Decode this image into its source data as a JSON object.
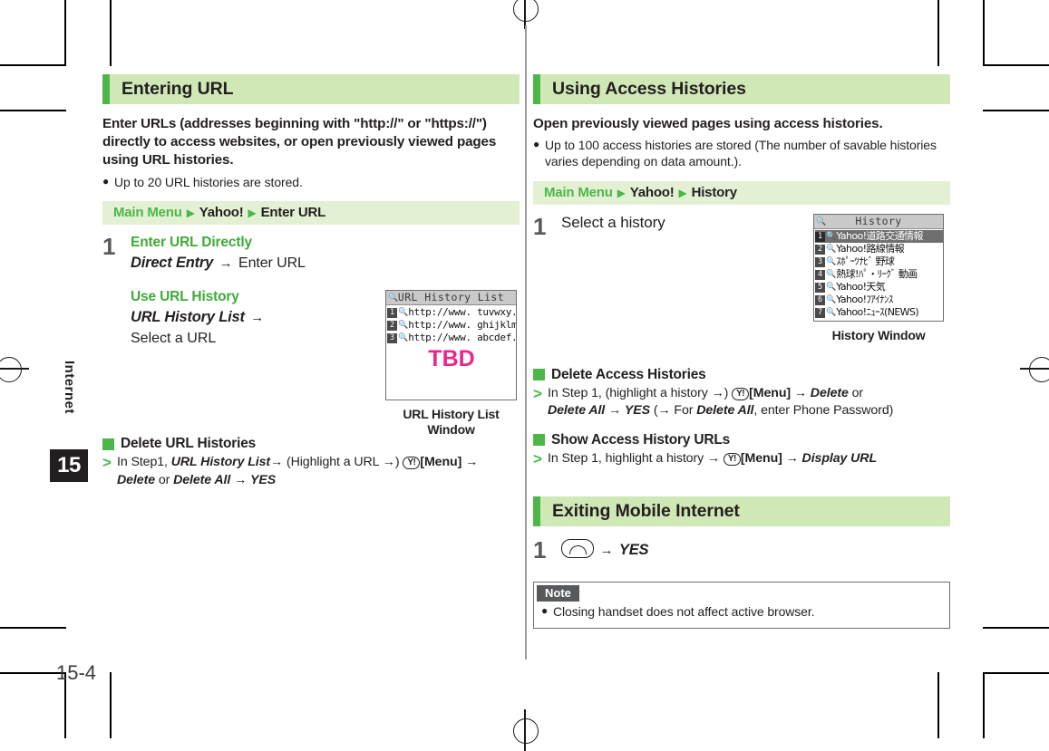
{
  "page": {
    "page_number": "15-4",
    "chapter_tab_label": "Internet",
    "chapter_number": "15"
  },
  "colors": {
    "accent_green": "#4cb748",
    "heading_bg": "#cfe8b6",
    "navbar_bg": "#e3f0d3",
    "tbd_magenta": "#e9268f",
    "note_header_bg": "#58595b"
  },
  "left_column": {
    "section": {
      "title": "Entering URL",
      "lead": "Enter URLs (addresses beginning with \"http://\" or \"https://\") directly to access websites, or open previously viewed pages using URL histories.",
      "bullets": [
        "Up to 20 URL histories are stored."
      ],
      "navbar": {
        "root": "Main Menu",
        "crumbs": [
          "Yahoo!",
          "Enter URL"
        ]
      },
      "step": {
        "number": "1",
        "block_a": {
          "heading": "Enter URL Directly",
          "italic": "Direct Entry",
          "arrow": "→",
          "tail": "Enter URL"
        },
        "block_b": {
          "heading": "Use URL History",
          "italic": "URL History List",
          "arrow": "→",
          "tail": "Select a URL"
        }
      },
      "screenshot": {
        "title": "URL History List",
        "magnifier_icon": "magnifier-icon",
        "rows": [
          {
            "index": "1",
            "text": "http://www. tuvwxy. xx",
            "selected": false
          },
          {
            "index": "2",
            "text": "http://www. ghijklmno",
            "selected": false
          },
          {
            "index": "3",
            "text": "http://www. abcdef. xx",
            "selected": false
          }
        ],
        "overlay_text": "TBD",
        "caption_line1": "URL History List",
        "caption_line2": "Window"
      },
      "subsections": [
        {
          "title": "Delete URL Histories",
          "line1_prefix": "In Step1, ",
          "line1_italic1": "URL History List",
          "line1_arrow1": "→",
          "line1_mid": " (Highlight a URL ",
          "line1_arrow2": "→",
          "line1_mid2": ") ",
          "key_icon": "yahoo-key-icon",
          "key_label": "Y!",
          "line1_menu": "[Menu]",
          "line1_arrow3": "→",
          "line2_italic1": "Delete",
          "line2_or": " or ",
          "line2_italic2": "Delete All",
          "line2_arrow": "→",
          "line2_italic3": "YES"
        }
      ]
    }
  },
  "right_column": {
    "section_histories": {
      "title": "Using Access Histories",
      "lead": "Open previously viewed pages using access histories.",
      "bullets": [
        "Up to 100 access histories are stored (The number of savable histories varies depending on data amount.)."
      ],
      "navbar": {
        "root": "Main Menu",
        "crumbs": [
          "Yahoo!",
          "History"
        ]
      },
      "step": {
        "number": "1",
        "text": "Select a history"
      },
      "screenshot": {
        "title": "History",
        "magnifier_icon": "magnifier-icon",
        "rows": [
          {
            "index": "1",
            "text": "Yahoo!道路交通情報",
            "selected": true
          },
          {
            "index": "2",
            "text": "Yahoo!路線情報",
            "selected": false
          },
          {
            "index": "3",
            "text": "ｽﾎﾟｰﾂﾅﾋﾞ 野球",
            "selected": false
          },
          {
            "index": "4",
            "text": "熱球!ﾊﾟ・ﾘｰｸﾞ 動画",
            "selected": false
          },
          {
            "index": "5",
            "text": "Yahoo!天気",
            "selected": false
          },
          {
            "index": "6",
            "text": "Yahoo!ﾌｱｲﾅﾝｽ",
            "selected": false
          },
          {
            "index": "7",
            "text": "Yahoo!ﾆｭｰｽ(NEWS)",
            "selected": false
          }
        ],
        "caption_line1": "History Window",
        "caption_line2": ""
      },
      "subsections": [
        {
          "title": "Delete Access Histories",
          "prefix": "In Step 1, (highlight a history ",
          "arrow1": "→",
          "mid": ") ",
          "key_icon": "yahoo-key-icon",
          "key_label": "Y!",
          "menu": "[Menu]",
          "arrow2": "→",
          "italic1": "Delete",
          "or": " or",
          "line2_italic1": "Delete All",
          "line2_arrow1": "→",
          "line2_italic2": "YES",
          "line2_paren_open": " (",
          "line2_arrow2": "→",
          "line2_for": " For ",
          "line2_italic3": "Delete All",
          "line2_tail": ", enter Phone Password)"
        },
        {
          "title": "Show Access History URLs",
          "prefix": "In Step 1, highlight a history ",
          "arrow1": "→",
          "key_icon": "yahoo-key-icon",
          "key_label": "Y!",
          "menu": "[Menu]",
          "arrow2": "→",
          "italic1": "Display URL"
        }
      ]
    },
    "section_exiting": {
      "title": "Exiting Mobile Internet",
      "step": {
        "number": "1",
        "key_icon": "end-call-key-icon",
        "arrow": "→",
        "italic": "YES"
      },
      "note": {
        "header": "Note",
        "bullets": [
          "Closing handset does not affect active browser."
        ]
      }
    }
  }
}
